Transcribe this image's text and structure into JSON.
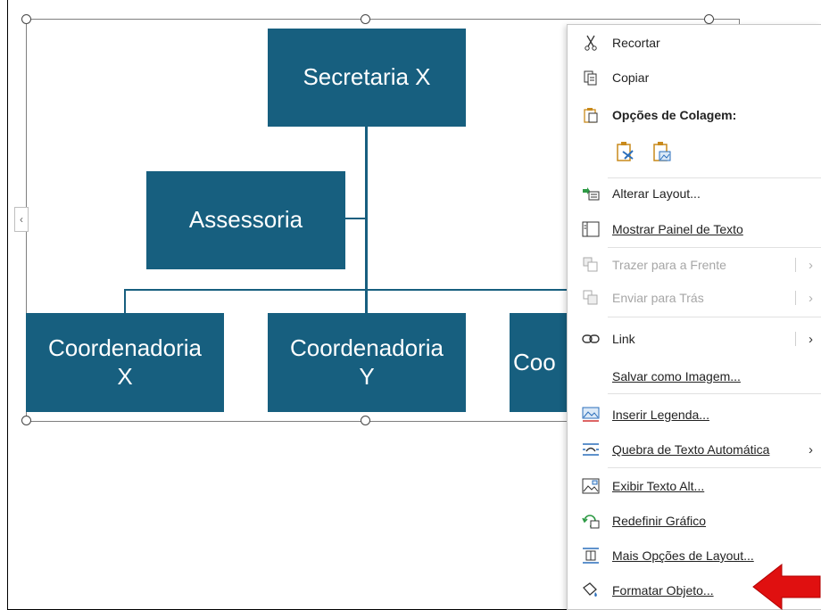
{
  "diagram": {
    "top_node": "Secretaria X",
    "assistant_node": "Assessoria",
    "children": [
      {
        "line1": "Coordenadoria",
        "line2": "X"
      },
      {
        "line1": "Coordenadoria",
        "line2": "Y"
      },
      {
        "line1": "Coo",
        "line2": ""
      }
    ]
  },
  "context_menu": {
    "cut": "Recortar",
    "copy": "Copiar",
    "paste_options": "Opções de Colagem:",
    "change_layout": "Alterar Layout...",
    "show_text_pane": "Mostrar Painel de Texto",
    "bring_to_front": "Trazer para a Frente",
    "send_to_back": "Enviar para Trás",
    "link": "Link",
    "save_as_image": "Salvar como Imagem...",
    "insert_caption": "Inserir Legenda...",
    "wrap_text": "Quebra de Texto Automática",
    "edit_alt_text": "Exibir Texto Alt...",
    "reset_graphic": "Redefinir Gráfico",
    "more_layout_options": "Mais Opções de Layout...",
    "format_object": "Formatar Objeto..."
  },
  "colors": {
    "node_fill": "#175f7f",
    "annotation_arrow": "#e01010"
  },
  "icons": [
    "scissors-icon",
    "copy-icon",
    "clipboard-icon",
    "paste-keep-icon",
    "paste-picture-icon",
    "layout-icon",
    "text-pane-icon",
    "bring-front-icon",
    "send-back-icon",
    "link-icon",
    "caption-icon",
    "wrap-text-icon",
    "alt-text-icon",
    "reset-graphic-icon",
    "layout-options-icon",
    "format-object-icon",
    "collapse-chevron-icon"
  ]
}
